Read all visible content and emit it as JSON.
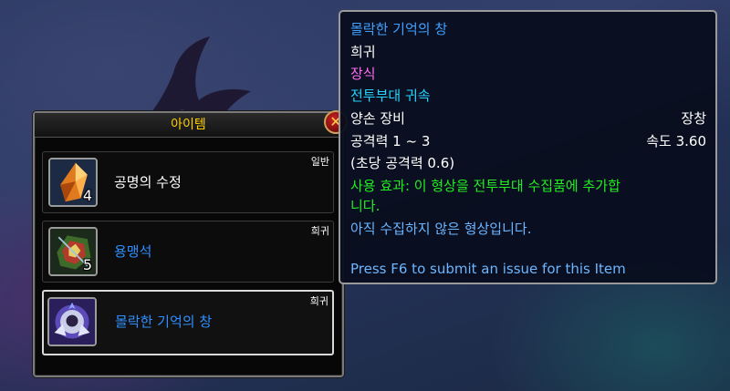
{
  "loot_window": {
    "title": "아이템",
    "close_icon": "close-x-icon",
    "items": [
      {
        "name": "공명의 수정",
        "count": "4",
        "quality": "일반",
        "icon": "resonance-crystal-icon",
        "name_color": "#ffffff"
      },
      {
        "name": "용맹석",
        "count": "5",
        "quality": "희귀",
        "icon": "valorstone-icon",
        "name_color": "#2f8fff"
      },
      {
        "name": "몰락한 기억의 창",
        "count": "",
        "quality": "희귀",
        "icon": "spear-transmog-icon",
        "name_color": "#2f8fff"
      }
    ]
  },
  "tooltip": {
    "item_name": "몰락한 기억의 창",
    "rarity": "희귀",
    "type": "장식",
    "binding": "전투부대 귀속",
    "slot_left": "양손 장비",
    "slot_right": "장창",
    "damage_left": "공격력 1 ~ 3",
    "damage_right": "속도 3.60",
    "dps": "(초당 공격력 0.6)",
    "use_effect_line1": "사용 효과: 이 형상을 전투부대 수집품에 추가합",
    "use_effect_line2": "니다.",
    "uncollected": "아직 수집하지 않은 형상입니다.",
    "footer": "Press F6 to submit an issue for this Item"
  }
}
